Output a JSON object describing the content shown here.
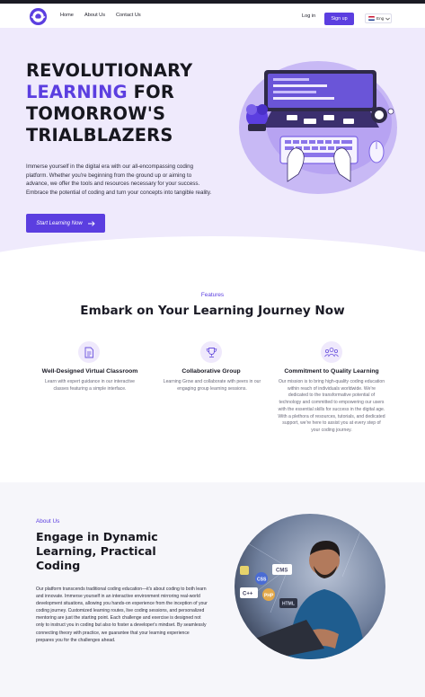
{
  "nav": {
    "links": [
      "Home",
      "About Us",
      "Contact Us"
    ],
    "login": "Log in",
    "signup": "Sign up",
    "language": "Eng"
  },
  "hero": {
    "title_line1": "REVOLUTIONARY",
    "title_line2_accent": "LEARNING",
    "title_line2_rest": " FOR",
    "title_line3": "TOMORROW'S",
    "title_line4": "TRIALBLAZERS",
    "description": "Immerse yourself in the digital era with our all-encompassing coding platform. Whether you're beginning from the ground up or aiming to advance, we offer the tools and resources necessary for your success. Embrace the potential of coding and turn your concepts into tangible reality.",
    "cta": "Start Learning Now"
  },
  "features": {
    "label": "Features",
    "title": "Embark on Your Learning Journey Now",
    "items": [
      {
        "icon": "document-icon",
        "title": "Well-Designed Virtual Classroom",
        "text": "Learn with expert guidance in our interactive classes featuring a simple interface."
      },
      {
        "icon": "trophy-icon",
        "title": "Collaborative Group",
        "text": "Learning Grow and collaborate with peers in our engaging group learning sessions."
      },
      {
        "icon": "group-icon",
        "title": "Commitment to Quality Learning",
        "text": "Our mission is to bring high-quality coding education within reach of individuals worldwide. We're dedicated to the transformative potential of technology and committed to empowering our users with the essential skills for success in the digital age. With a plethora of resources, tutorials, and dedicated support, we're here to assist you at every step of your coding journey."
      }
    ]
  },
  "about": {
    "label": "About Us",
    "title": "Engage in Dynamic Learning, Practical Coding",
    "text": "Our platform transcends traditional coding education—it's about coding to both learn and innovate. Immerse yourself in an interactive environment mirroring real-world development situations, allowing you hands-on experience from the inception of your coding journey. Customized learning routes, live coding sessions, and personalized mentoring are just the starting point. Each challenge and exercise is designed not only to instruct you in coding but also to foster a developer's mindset. By seamlessly connecting theory with practice, we guarantee that your learning experience prepares you for the challenges ahead.",
    "photo_badges": [
      "CMS",
      "CSS",
      "C++",
      "PHP",
      "HTML"
    ]
  },
  "colors": {
    "accent": "#5b3ee0",
    "hero_bg": "#efeafc",
    "about_bg": "#f6f6fa"
  }
}
